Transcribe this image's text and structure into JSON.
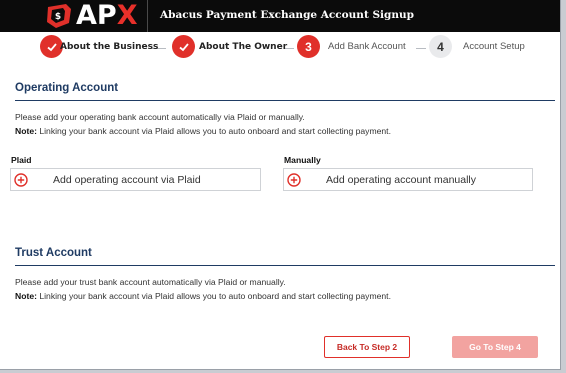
{
  "brand": {
    "logo_text_a": "AP",
    "logo_text_x": "X",
    "accent": "#e0302a"
  },
  "app_title": "Abacus Payment Exchange Account Signup",
  "steps": [
    {
      "number": "1",
      "label": "About the Business",
      "status": "done"
    },
    {
      "number": "2",
      "label": "About The Owner",
      "status": "done"
    },
    {
      "number": "3",
      "label": "Add Bank Account",
      "status": "active"
    },
    {
      "number": "4",
      "label": "Account Setup",
      "status": "pending"
    }
  ],
  "operating": {
    "title": "Operating Account",
    "line1": "Please add your operating bank account automatically via Plaid or manually.",
    "note_label": "Note:",
    "note_text": " Linking your bank account via Plaid allows you to auto onboard and start collecting payment.",
    "plaid_label": "Plaid",
    "plaid_button": "Add operating account via Plaid",
    "manual_label": "Manually",
    "manual_button": "Add operating account manually"
  },
  "trust": {
    "title": "Trust Account",
    "line1": "Please add your trust bank account automatically via Plaid or manually.",
    "note_label": "Note:",
    "note_text": " Linking your bank account via Plaid allows you to auto onboard and start collecting payment."
  },
  "buttons": {
    "back": "Back To Step 2",
    "next": "Go To Step 4"
  }
}
